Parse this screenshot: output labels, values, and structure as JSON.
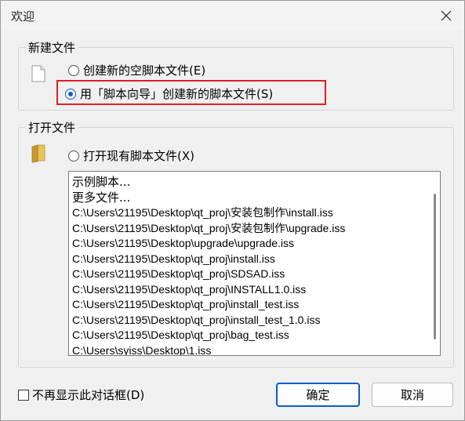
{
  "window": {
    "title": "欢迎",
    "close_icon": "close-icon"
  },
  "new_file_group": {
    "legend": "新建文件",
    "options": [
      {
        "label": "创建新的空脚本文件(E)",
        "checked": false
      },
      {
        "label": "用「脚本向导」创建新的脚本文件(S)",
        "checked": true
      }
    ],
    "highlight_color": "#e01c24"
  },
  "open_file_group": {
    "legend": "打开文件",
    "option": {
      "label": "打开现有脚本文件(X)",
      "checked": false
    },
    "recent_files": [
      "示例脚本...",
      "更多文件...",
      "C:\\Users\\21195\\Desktop\\qt_proj\\安装包制作\\install.iss",
      "C:\\Users\\21195\\Desktop\\qt_proj\\安装包制作\\upgrade.iss",
      "C:\\Users\\21195\\Desktop\\upgrade\\upgrade.iss",
      "C:\\Users\\21195\\Desktop\\qt_proj\\install.iss",
      "C:\\Users\\21195\\Desktop\\qt_proj\\SDSAD.iss",
      "C:\\Users\\21195\\Desktop\\qt_proj\\INSTALL1.0.iss",
      "C:\\Users\\21195\\Desktop\\qt_proj\\install_test.iss",
      "C:\\Users\\21195\\Desktop\\qt_proj\\install_test_1.0.iss",
      "C:\\Users\\21195\\Desktop\\qt_proj\\bag_test.iss",
      "C:\\Users\\syiss\\Desktop\\1.iss"
    ]
  },
  "footer": {
    "dont_show_label": "不再显示此对话框(D)",
    "dont_show_checked": false,
    "ok_label": "确定",
    "cancel_label": "取消"
  },
  "colors": {
    "accent": "#0a5ccc",
    "background": "#f0f0f0"
  }
}
